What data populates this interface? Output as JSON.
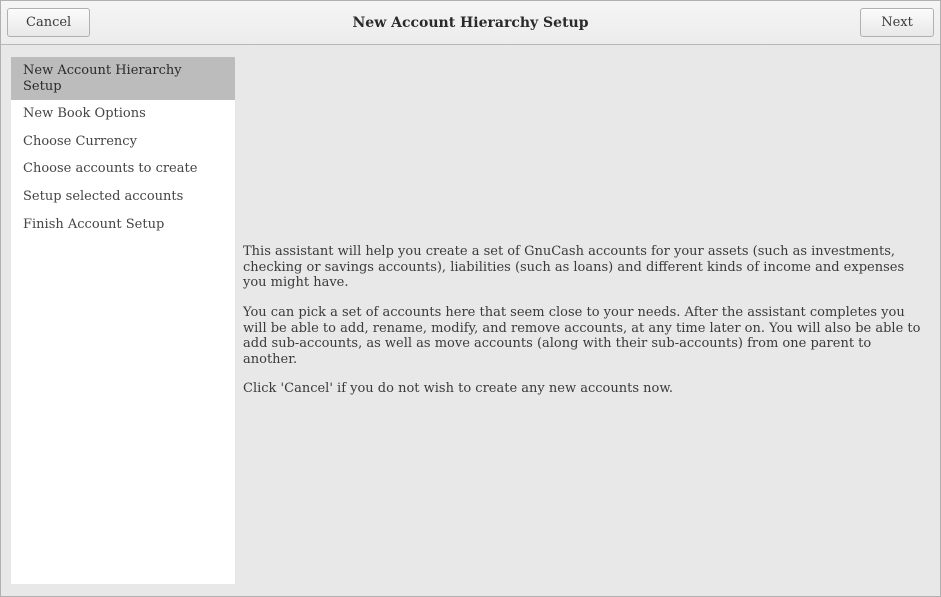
{
  "header": {
    "title": "New Account Hierarchy Setup",
    "cancel_label": "Cancel",
    "next_label": "Next"
  },
  "sidebar": {
    "items": [
      {
        "label": "New Account Hierarchy Setup",
        "selected": true
      },
      {
        "label": "New Book Options",
        "selected": false
      },
      {
        "label": "Choose Currency",
        "selected": false
      },
      {
        "label": "Choose accounts to create",
        "selected": false
      },
      {
        "label": "Setup selected accounts",
        "selected": false
      },
      {
        "label": "Finish Account Setup",
        "selected": false
      }
    ]
  },
  "main": {
    "paragraphs": [
      "This assistant will help you create a set of GnuCash accounts for your assets (such as investments, checking or savings accounts), liabilities (such as loans) and different kinds of income and expenses you might have.",
      "You can pick a set of accounts here that seem close to your needs. After the assistant completes you will be able to add, rename, modify, and remove accounts, at any time later on. You will also be able to add sub-accounts, as well as move accounts (along with their sub-accounts) from one parent to another.",
      "Click 'Cancel'  if you do not wish to create any new accounts now."
    ]
  }
}
